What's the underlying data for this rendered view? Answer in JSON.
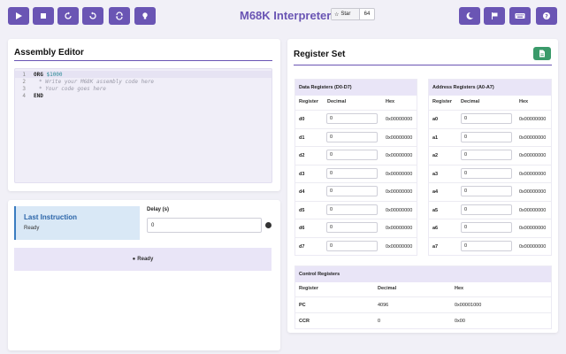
{
  "header": {
    "title": "M68K Interpreter",
    "star_label": "Star",
    "star_count": "64",
    "left_buttons": [
      "play-icon",
      "stop-icon",
      "step-icon",
      "undo-icon",
      "reset-icon",
      "hint-icon"
    ],
    "right_buttons": [
      "moon-icon",
      "flag-icon",
      "keyboard-icon",
      "help-icon"
    ]
  },
  "editor_panel": {
    "title": "Assembly Editor",
    "lines": [
      {
        "n": "1",
        "kw": "ORG",
        "arg": "$1000",
        "comment": ""
      },
      {
        "n": "2",
        "kw": "",
        "arg": "",
        "comment": "* Write your M68K assembly code here"
      },
      {
        "n": "3",
        "kw": "",
        "arg": "",
        "comment": "* Your code goes here"
      },
      {
        "n": "4",
        "kw": "END",
        "arg": "",
        "comment": ""
      }
    ]
  },
  "execution": {
    "last_instruction_title": "Last Instruction",
    "last_instruction_value": "Ready",
    "delay_label": "Delay (s)",
    "delay_value": "0",
    "status": "Ready"
  },
  "registers": {
    "title": "Register Set",
    "data": {
      "title": "Data Registers (D0-D7)",
      "cols": [
        "Register",
        "Decimal",
        "Hex"
      ],
      "rows": [
        {
          "name": "d0",
          "dec": "0",
          "hex": "0x00000000"
        },
        {
          "name": "d1",
          "dec": "0",
          "hex": "0x00000000"
        },
        {
          "name": "d2",
          "dec": "0",
          "hex": "0x00000000"
        },
        {
          "name": "d3",
          "dec": "0",
          "hex": "0x00000000"
        },
        {
          "name": "d4",
          "dec": "0",
          "hex": "0x00000000"
        },
        {
          "name": "d5",
          "dec": "0",
          "hex": "0x00000000"
        },
        {
          "name": "d6",
          "dec": "0",
          "hex": "0x00000000"
        },
        {
          "name": "d7",
          "dec": "0",
          "hex": "0x00000000"
        }
      ]
    },
    "address": {
      "title": "Address Registers (A0-A7)",
      "cols": [
        "Register",
        "Decimal",
        "Hex"
      ],
      "rows": [
        {
          "name": "a0",
          "dec": "0",
          "hex": "0x00000000"
        },
        {
          "name": "a1",
          "dec": "0",
          "hex": "0x00000000"
        },
        {
          "name": "a2",
          "dec": "0",
          "hex": "0x00000000"
        },
        {
          "name": "a3",
          "dec": "0",
          "hex": "0x00000000"
        },
        {
          "name": "a4",
          "dec": "0",
          "hex": "0x00000000"
        },
        {
          "name": "a5",
          "dec": "0",
          "hex": "0x00000000"
        },
        {
          "name": "a6",
          "dec": "0",
          "hex": "0x00000000"
        },
        {
          "name": "a7",
          "dec": "0",
          "hex": "0x00000000"
        }
      ]
    },
    "control": {
      "title": "Control Registers",
      "cols": [
        "Register",
        "Decimal",
        "Hex"
      ],
      "rows": [
        {
          "name": "PC",
          "dec": "4096",
          "hex": "0x00001000"
        },
        {
          "name": "CCR",
          "dec": "0",
          "hex": "0x00"
        }
      ]
    }
  },
  "colors": {
    "accent": "#6a55b4",
    "save": "#3a9a6a",
    "info": "#3a7cc0"
  }
}
